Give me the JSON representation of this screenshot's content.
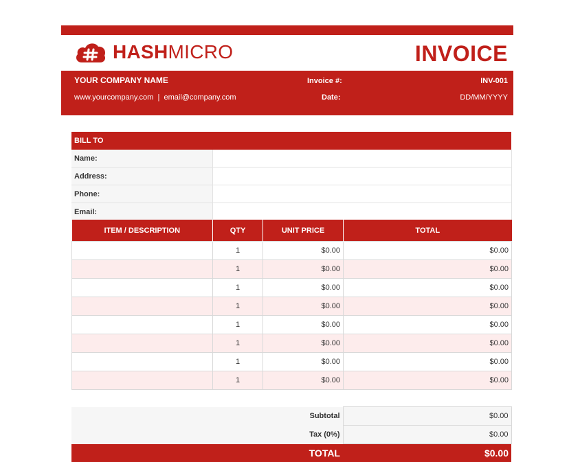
{
  "brand": {
    "name_bold": "HASH",
    "name_regular": "MICRO",
    "color": "#c0201a"
  },
  "document_title": "INVOICE",
  "header": {
    "company_name": "YOUR COMPANY NAME",
    "website": "www.yourcompany.com",
    "separator": "|",
    "email": "email@company.com",
    "invoice_number_label": "Invoice #:",
    "invoice_number": "INV-001",
    "date_label": "Date:",
    "date_value": "DD/MM/YYYY"
  },
  "bill_to": {
    "heading": "BILL TO",
    "fields": [
      {
        "label": "Name:",
        "value": ""
      },
      {
        "label": "Address:",
        "value": ""
      },
      {
        "label": "Phone:",
        "value": ""
      },
      {
        "label": "Email:",
        "value": ""
      }
    ]
  },
  "items_table": {
    "columns": [
      "ITEM / DESCRIPTION",
      "QTY",
      "UNIT PRICE",
      "TOTAL"
    ],
    "rows": [
      {
        "description": "",
        "qty": "1",
        "unit_price": "$0.00",
        "total": "$0.00"
      },
      {
        "description": "",
        "qty": "1",
        "unit_price": "$0.00",
        "total": "$0.00"
      },
      {
        "description": "",
        "qty": "1",
        "unit_price": "$0.00",
        "total": "$0.00"
      },
      {
        "description": "",
        "qty": "1",
        "unit_price": "$0.00",
        "total": "$0.00"
      },
      {
        "description": "",
        "qty": "1",
        "unit_price": "$0.00",
        "total": "$0.00"
      },
      {
        "description": "",
        "qty": "1",
        "unit_price": "$0.00",
        "total": "$0.00"
      },
      {
        "description": "",
        "qty": "1",
        "unit_price": "$0.00",
        "total": "$0.00"
      },
      {
        "description": "",
        "qty": "1",
        "unit_price": "$0.00",
        "total": "$0.00"
      }
    ]
  },
  "totals": {
    "subtotal_label": "Subtotal",
    "subtotal_value": "$0.00",
    "tax_label": "Tax (0%)",
    "tax_value": "$0.00",
    "grand_total_label": "TOTAL",
    "grand_total_value": "$0.00"
  }
}
